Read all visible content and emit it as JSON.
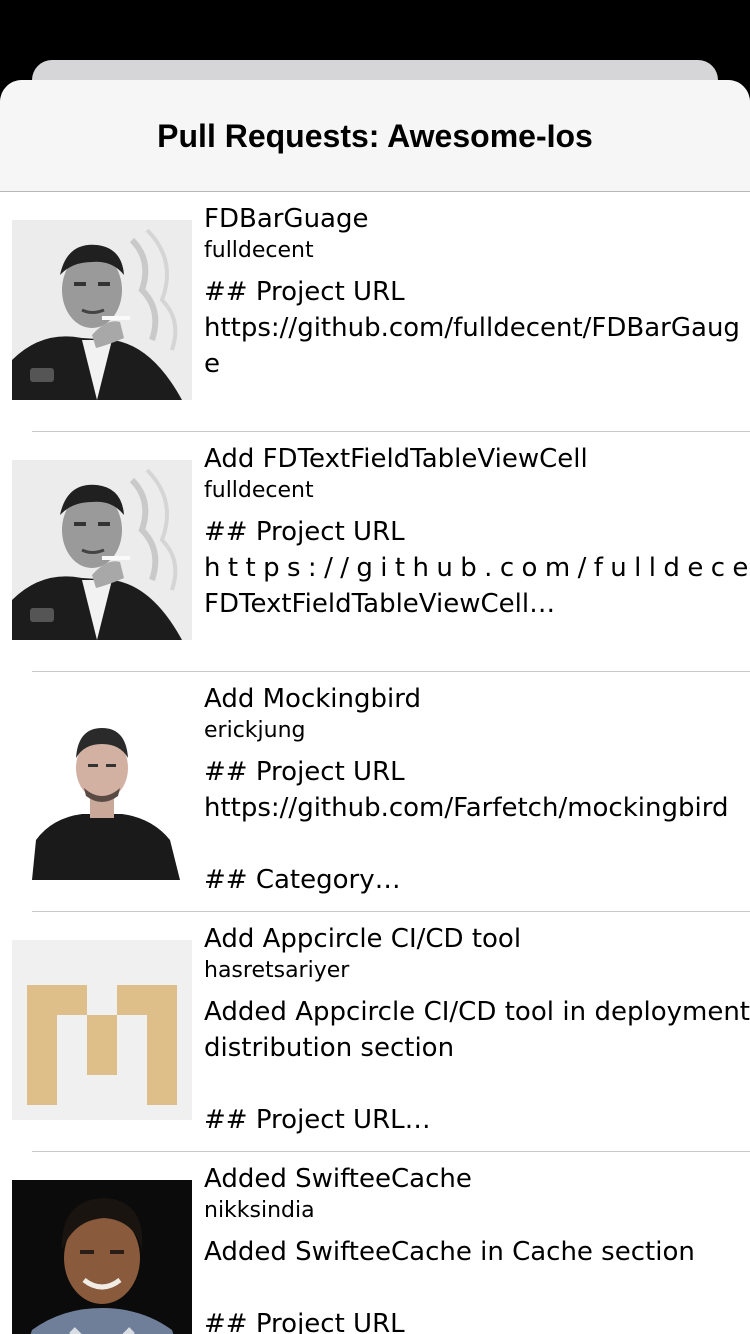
{
  "nav": {
    "title": "Pull Requests: Awesome-Ios"
  },
  "rows": [
    {
      "title": "FDBarGuage",
      "user": "fulldecent",
      "body": "## Project URL\nhttps://github.com/fulldecent/FDBarGauge\n\n## Category…",
      "avatar": "man-smoking-photo"
    },
    {
      "title": "Add FDTextFieldTableViewCell",
      "user": "fulldecent",
      "body_line1": "## Project URL",
      "body_line2": "https://github.com/fulldecent/",
      "body_line3": "FDTextFieldTableViewCell…",
      "avatar": "man-smoking-photo"
    },
    {
      "title": "Add Mockingbird",
      "user": "erickjung",
      "body": "## Project URL\nhttps://github.com/Farfetch/mockingbird\n\n## Category…",
      "avatar": "man-black-tshirt-photo"
    },
    {
      "title": "Add Appcircle CI/CD tool",
      "user": "hasretsariyer",
      "body": "Added Appcircle CI/CD tool in deployment distribution section\n\n## Project URL…",
      "avatar": "identicon-tan"
    },
    {
      "title": "Added SwifteeCache",
      "user": "nikksindia",
      "body": "Added SwifteeCache in Cache section\n\n## Project URL",
      "avatar": "man-smiling-photo"
    }
  ],
  "colors": {
    "nav_bg": "#f6f6f6",
    "separator": "#c8c8cc",
    "identicon": "#dfbf89",
    "identicon_bg": "#f0f0f0"
  }
}
